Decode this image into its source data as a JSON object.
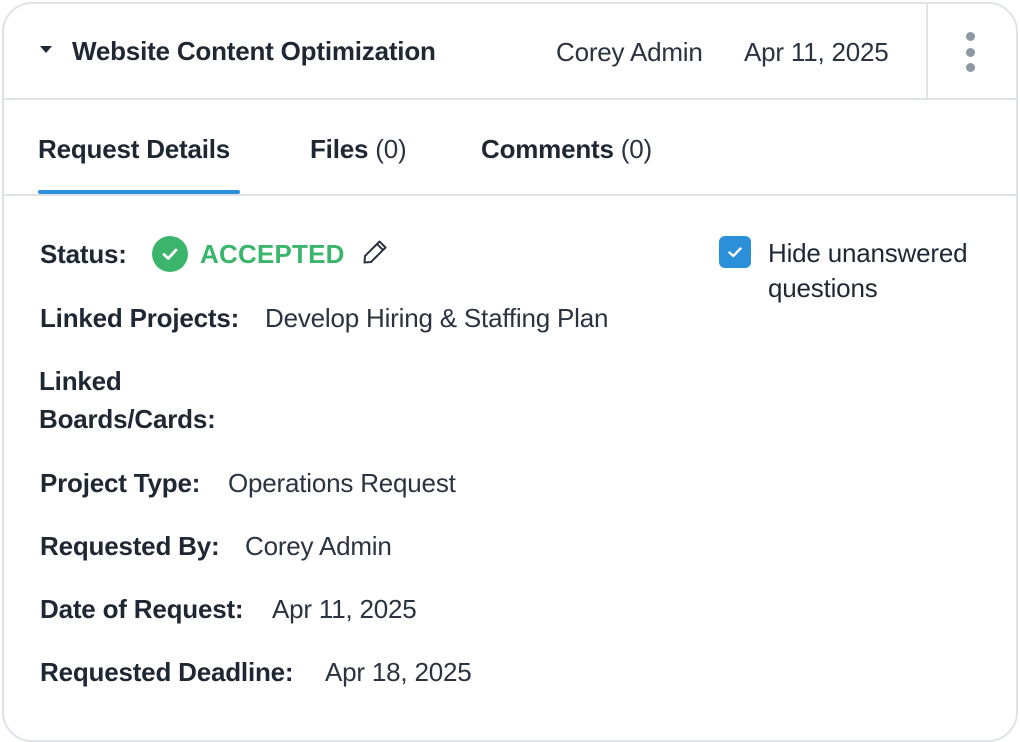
{
  "header": {
    "title": "Website Content Optimization",
    "user": "Corey Admin",
    "date": "Apr 11, 2025",
    "expand_icon": "caret-down-icon",
    "menu_icon": "kebab-menu-icon"
  },
  "tabs": [
    {
      "name": "Request Details",
      "count": "",
      "active": true
    },
    {
      "name": "Files",
      "count": "(0)",
      "active": false
    },
    {
      "name": "Comments",
      "count": "(0)",
      "active": false
    }
  ],
  "details": {
    "status": {
      "label": "Status:",
      "value": "ACCEPTED",
      "color": "#3bb56c"
    },
    "linked_projects": {
      "label": "Linked Projects:",
      "value": "Develop Hiring & Staffing Plan"
    },
    "linked_boards": {
      "label_line1": "Linked",
      "label_line2": "Boards/Cards:",
      "value": ""
    },
    "project_type": {
      "label": "Project Type:",
      "value": "Operations Request"
    },
    "requested_by": {
      "label": "Requested By:",
      "value": "Corey Admin"
    },
    "date_of_request": {
      "label": "Date of Request:",
      "value": "Apr 11, 2025"
    },
    "requested_deadline": {
      "label": "Requested Deadline:",
      "value": "Apr 18, 2025"
    }
  },
  "hide_unanswered": {
    "checked": true,
    "label": "Hide unanswered questions"
  },
  "colors": {
    "accent": "#2b8fd9",
    "success": "#3bb56c",
    "border": "#dfe3e8",
    "text": "#1f2733"
  }
}
